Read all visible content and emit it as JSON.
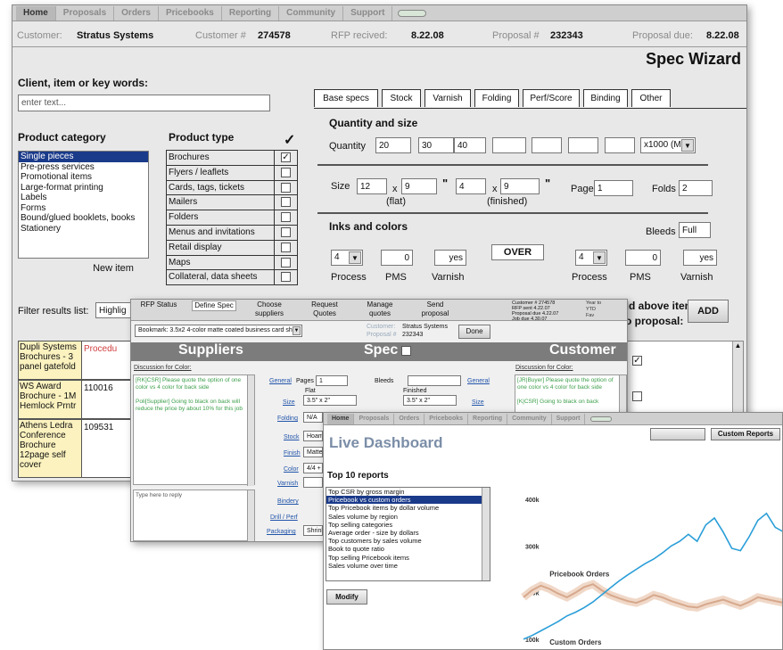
{
  "wizard": {
    "nav": [
      "Home",
      "Proposals",
      "Orders",
      "Pricebooks",
      "Reporting",
      "Community",
      "Support"
    ],
    "customer_label": "Customer:",
    "customer_name": "Stratus Systems",
    "customer_num_label": "Customer #",
    "customer_num": "274578",
    "rfp_label": "RFP recived:",
    "rfp_date": "8.22.08",
    "proposal_label": "Proposal #",
    "proposal_num": "232343",
    "due_label": "Proposal due:",
    "due_date": "8.22.08",
    "title": "Spec Wizard",
    "search_label": "Client, item or key words:",
    "search_placeholder": "enter text...",
    "product_category_heading": "Product category",
    "product_categories": [
      "Single pieces",
      "Pre-press services",
      "Promotional items",
      "Large-format printing",
      "Labels",
      "Forms",
      "Bound/glued booklets, books",
      "Stationery"
    ],
    "new_item_button": "New item",
    "product_type_heading": "Product type",
    "checkmark": "✓",
    "product_types": [
      {
        "label": "Brochures",
        "checked": true
      },
      {
        "label": "Flyers / leaflets",
        "checked": false
      },
      {
        "label": "Cards, tags, tickets",
        "checked": false
      },
      {
        "label": "Mailers",
        "checked": false
      },
      {
        "label": "Folders",
        "checked": false
      },
      {
        "label": "Menus and invitations",
        "checked": false
      },
      {
        "label": "Retail display",
        "checked": false
      },
      {
        "label": "Maps",
        "checked": false
      },
      {
        "label": "Collateral, data sheets",
        "checked": false
      }
    ],
    "tabs": [
      "Base specs",
      "Stock",
      "Varnish",
      "Folding",
      "Perf/Score",
      "Binding",
      "Other"
    ],
    "qty_heading": "Quantity and size",
    "qty_label": "Quantity",
    "qty_values": [
      "20",
      "30",
      "40",
      "",
      "",
      "",
      ""
    ],
    "qty_unit": "x1000 (M)",
    "size_label": "Size",
    "flat_w": "12",
    "x1": "x",
    "flat_h": "9",
    "inch1": "\"",
    "finished_w": "4",
    "x2": "x",
    "finished_h": "9",
    "inch2": "\"",
    "flat_label": "(flat)",
    "finished_label": "(finished)",
    "pages_label": "Pages",
    "pages_value": "1",
    "folds_label": "Folds",
    "folds_value": "2",
    "inks_heading": "Inks and colors",
    "bleeds_label": "Bleeds",
    "bleeds_value": "Full",
    "process_value_1": "4",
    "pms_value_1": "0",
    "varnish_value_1": "yes",
    "over_label": "OVER",
    "process_value_2": "4",
    "pms_value_2": "0",
    "varnish_value_2": "yes",
    "process_label": "Process",
    "pms_label": "PMS",
    "varnish_label": "Varnish",
    "filter_label": "Filter results list:",
    "filter_value": "Highlig",
    "add_prompt_1": "Add above item",
    "add_prompt_2": "to proposal:",
    "add_button": "ADD",
    "results": [
      {
        "name": "Dupli Systems Brochures - 3 panel gatefold",
        "num": "Procedu",
        "checked": true
      },
      {
        "name": "WS Award Brochure - 1M Hemlock Prntr",
        "num": "110016",
        "checked": false
      },
      {
        "name": "Athens Ledra Conference Brochure 12page self cover",
        "num": "109531",
        "checked": false
      }
    ]
  },
  "spec": {
    "tabs": [
      "RFP Status",
      "Define Spec",
      "Choose suppliers",
      "Request Quotes",
      "Manage quotes",
      "Send proposal"
    ],
    "summary": {
      "customer_label": "Customer #",
      "customer_num": "274578",
      "rfp_label": "RFP sent",
      "rfp_date": "4.22.07",
      "proposal_label": "Proposal due",
      "proposal_date": "4.22.07",
      "job_label": "Job due",
      "job_date": "4.30.07"
    },
    "mini_text": [
      "Year to",
      "YTD",
      "Fav"
    ],
    "bookmark_value": "Bookmark: 3.5x2 4-color matte coated business card sh",
    "customer_label": "Customer:",
    "customer_name": "Stratus Systems",
    "proposal_label": "Proposal #",
    "proposal_num": "232343",
    "done_button": "Done",
    "suppliers_title": "Suppliers",
    "spec_title": "Spec",
    "customer_title": "Customer",
    "discussion_left_label": "Discussion for Color:",
    "discussion_left_text": "[RK]CSR] Please quote the option of one color vs 4 color for back side\n\nPoli[Supplier] Going to black on back will reduce the price by about 10% for this job",
    "reply_placeholder": "Type here to reply",
    "general_left": "General",
    "general_right": "General",
    "pages_label": "Pages",
    "pages_value": "1",
    "bleeds_label": "Bleeds",
    "flat_label": "Flat",
    "flat_value": "3.5\" x 2\"",
    "finished_label": "Finished",
    "finished_value": "3.5\" x 2\"",
    "size_label": "Size",
    "size_right": "Size",
    "folding_label": "Folding",
    "folding_value": "N/A",
    "stock_label": "Stock",
    "stock_value": "Hoam",
    "finish_label": "Finish",
    "finish_value": "Matte",
    "color_label": "Color",
    "color_value": "4/4 +",
    "varnish_label": "Varnish",
    "bindery_label": "Bindery",
    "drill_label": "Drill / Perf",
    "packaging_label": "Packaging",
    "packaging_value": "Shrink",
    "discussion_right_label": "Discussion for Color:",
    "discussion_right_text": "[JR|Buyer] Please quote the option of one color vs 4 color for back side\n\n[K|CSR] Going to black on back"
  },
  "dashboard": {
    "nav": [
      "Home",
      "Proposals",
      "Orders",
      "Pricebooks",
      "Reporting",
      "Community",
      "Support"
    ],
    "title": "Live Dashboard",
    "custom_reports_button": "Custom Reports",
    "reports_heading": "Top 10 reports",
    "reports": [
      "Top CSR by gross margin",
      "Pricebook vs custom orders",
      "Top Pricebook items by dollar volume",
      "Sales volume by region",
      "Top selling categories",
      "Average order - size by dollars",
      "Top customers by sales volume",
      "Book to quote ratio",
      "Top selling Pricebook items",
      "Sales volume over time"
    ],
    "modify_button": "Modify",
    "chart_data": {
      "type": "line",
      "title": "",
      "xlabel": "",
      "ylabel": "",
      "ylim": [
        75,
        425
      ],
      "y_ticks": [
        "400k",
        "300k",
        "200k",
        "100k"
      ],
      "y_tick_values": [
        400,
        300,
        200,
        100
      ],
      "x": [
        0,
        1,
        2,
        3,
        4,
        5,
        6,
        7,
        8,
        9,
        10,
        11,
        12,
        13,
        14,
        15,
        16,
        17,
        18,
        19,
        20,
        21,
        22,
        23,
        24,
        25,
        26,
        27,
        28,
        29,
        30
      ],
      "series": [
        {
          "name": "Pricebook Orders",
          "color": "#d6a88c",
          "values": [
            190,
            205,
            215,
            208,
            198,
            190,
            200,
            212,
            218,
            205,
            195,
            188,
            182,
            178,
            185,
            195,
            190,
            182,
            176,
            170,
            168,
            175,
            180,
            185,
            178,
            172,
            180,
            190,
            186,
            182,
            178
          ]
        },
        {
          "name": "Custom Orders",
          "color": "#2a9ed8",
          "values": [
            100,
            108,
            118,
            128,
            138,
            150,
            158,
            168,
            180,
            195,
            210,
            225,
            238,
            250,
            262,
            272,
            285,
            300,
            310,
            325,
            310,
            345,
            360,
            330,
            295,
            290,
            320,
            355,
            370,
            340,
            330
          ]
        }
      ]
    }
  }
}
